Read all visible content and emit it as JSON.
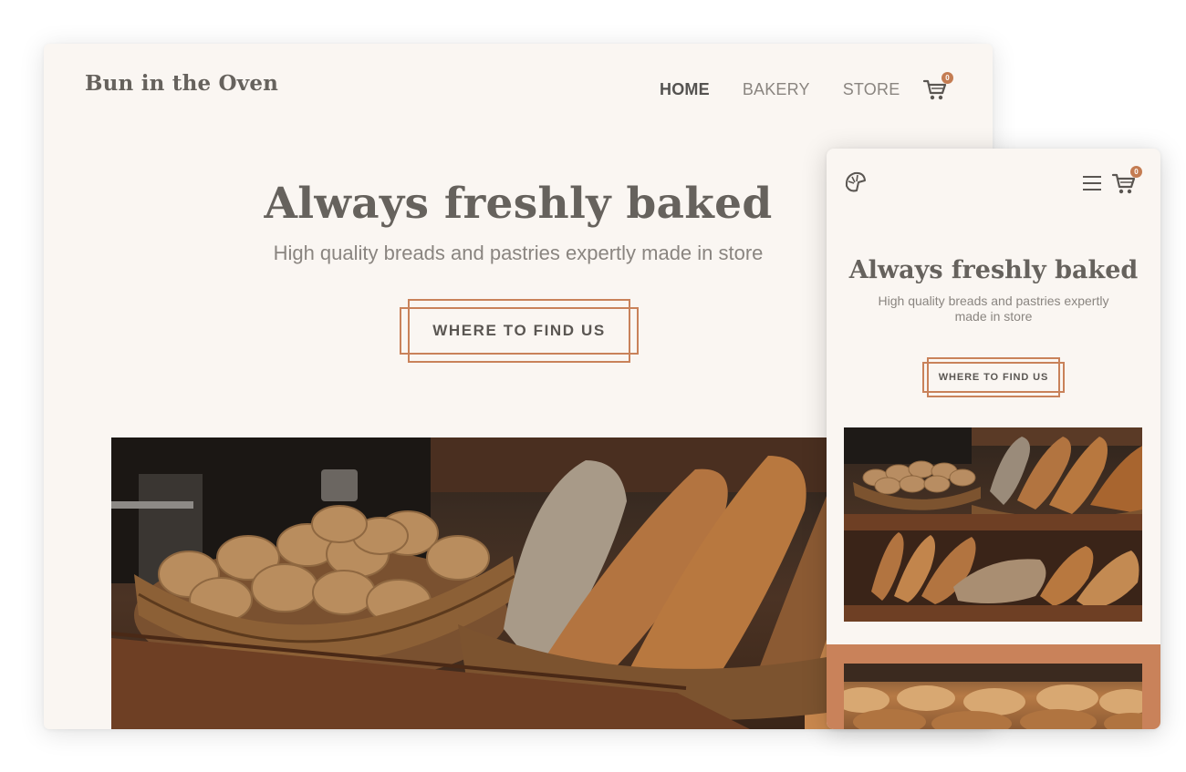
{
  "desktop": {
    "brand": "Bun in the Oven",
    "nav": [
      {
        "label": "HOME",
        "active": true
      },
      {
        "label": "BAKERY",
        "active": false
      },
      {
        "label": "STORE",
        "active": false
      }
    ],
    "cart_count": "0",
    "hero": {
      "title": "Always freshly baked",
      "subtitle": "High quality breads and pastries expertly made in store",
      "cta": "WHERE TO FIND US"
    },
    "image": "bread-basket-photo"
  },
  "mobile": {
    "logo_icon": "croissant-icon",
    "menu_icon": "hamburger-menu-icon",
    "cart_count": "0",
    "hero": {
      "title": "Always freshly baked",
      "subtitle": "High quality breads and pastries expertly made in store",
      "cta": "WHERE TO FIND US"
    },
    "image": "bakery-shelves-photo"
  },
  "colors": {
    "background": "#faf6f2",
    "accent": "#c9825a",
    "text_dark": "#66625d",
    "text_muted": "#8a8580"
  }
}
